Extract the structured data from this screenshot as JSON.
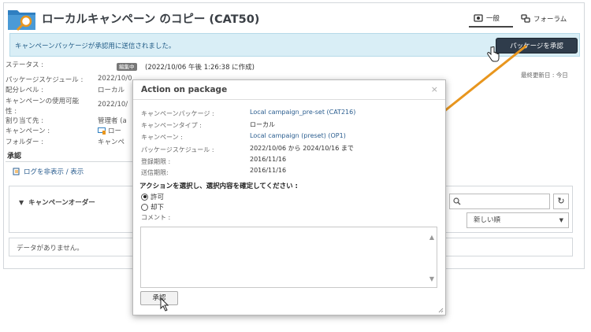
{
  "header": {
    "title": "ローカルキャンペーン のコピー (CAT50)",
    "tabs": [
      {
        "label": "一般",
        "icon": "globe-icon"
      },
      {
        "label": "フォーラム",
        "icon": "forum-icon"
      }
    ]
  },
  "notice": {
    "text": "キャンペーンパッケージが承認用に送信されました。",
    "button_label": "パッケージを承認"
  },
  "info": {
    "status_label": "ステータス :",
    "status_badge": "編集中",
    "status_note": "(2022/10/06 午後 1:26:38 に作成)",
    "schedule_label": "パッケージスケジュール :",
    "schedule_value": "2022/10/0",
    "distribution_label": "配分レベル :",
    "distribution_value": "ローカル",
    "availability_label_1": "キャンペーンの使用可能",
    "availability_label_2": "性 :",
    "availability_value": "2022/10/",
    "assigned_label": "割り当て先 :",
    "assigned_value": "管理者 (a",
    "campaign_label": "キャンペーン :",
    "campaign_value": "ロー",
    "folder_label": "フォルダー :",
    "folder_value": "キャンペ",
    "last_update": "最終更新日 : 今日"
  },
  "approval": {
    "section_title": "承認",
    "log_toggle": "ログを非表示 / 表示",
    "orders_title": "キャンペーンオーダー",
    "sort_value": "新しい順",
    "no_data": "データがありません。"
  },
  "modal": {
    "title": "Action on package",
    "close": "×",
    "rows": [
      {
        "label": "キャンペーンパッケージ :",
        "value": "Local campaign_pre-set (CAT216)",
        "link": true
      },
      {
        "label": "キャンペーンタイプ :",
        "value": "ローカル",
        "link": false
      },
      {
        "label": "キャンペーン :",
        "value": "Local campaign (preset) (OP1)",
        "link": true
      },
      {
        "label": "パッケージスケジュール :",
        "value": "2022/10/06 から 2024/10/16 まで",
        "link": false
      },
      {
        "label": "登録期限 :",
        "value": "2016/11/16",
        "link": false
      },
      {
        "label": "送信期限:",
        "value": "2016/11/16",
        "link": false
      }
    ],
    "prompt": "アクションを選択し、選択内容を確定してください :",
    "option_allow": "許可",
    "option_reject": "却下",
    "comment_label": "コメント :",
    "submit_label": "承認"
  },
  "colors": {
    "notice_bg": "#d9eef6",
    "button_dark": "#2f3c4b",
    "link": "#2a5d8f",
    "arrow": "#e8961e"
  }
}
